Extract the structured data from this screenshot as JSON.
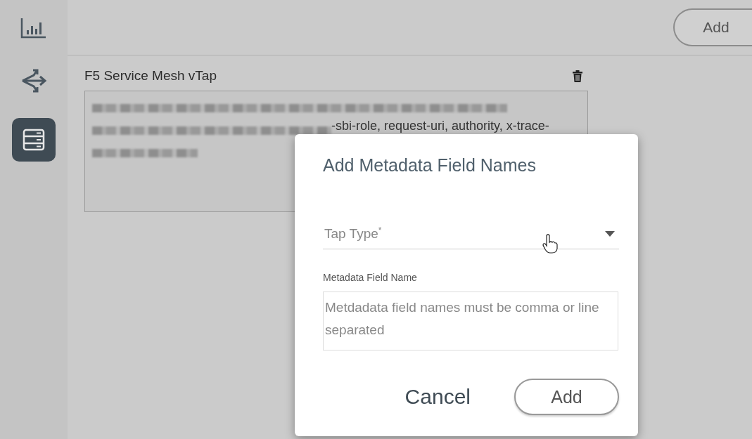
{
  "sidebar": {
    "items": [
      {
        "kind": "chart",
        "selected": false
      },
      {
        "kind": "routes",
        "selected": false
      },
      {
        "kind": "server",
        "selected": true
      }
    ]
  },
  "toolbar": {
    "add_button": "Add"
  },
  "card": {
    "title": "F5 Service Mesh vTap",
    "fields_text": "-sbi-role, request-uri, authority, x-trace-"
  },
  "dialog": {
    "title": "Add Metadata Field Names",
    "tap_type": {
      "placeholder": "Tap Type",
      "required_mark": "*"
    },
    "field_label": "Metadata Field Name",
    "field_names": {
      "placeholder": "Metdadata field names must be comma or line separated"
    },
    "buttons": {
      "cancel": "Cancel",
      "add": "Add"
    }
  }
}
